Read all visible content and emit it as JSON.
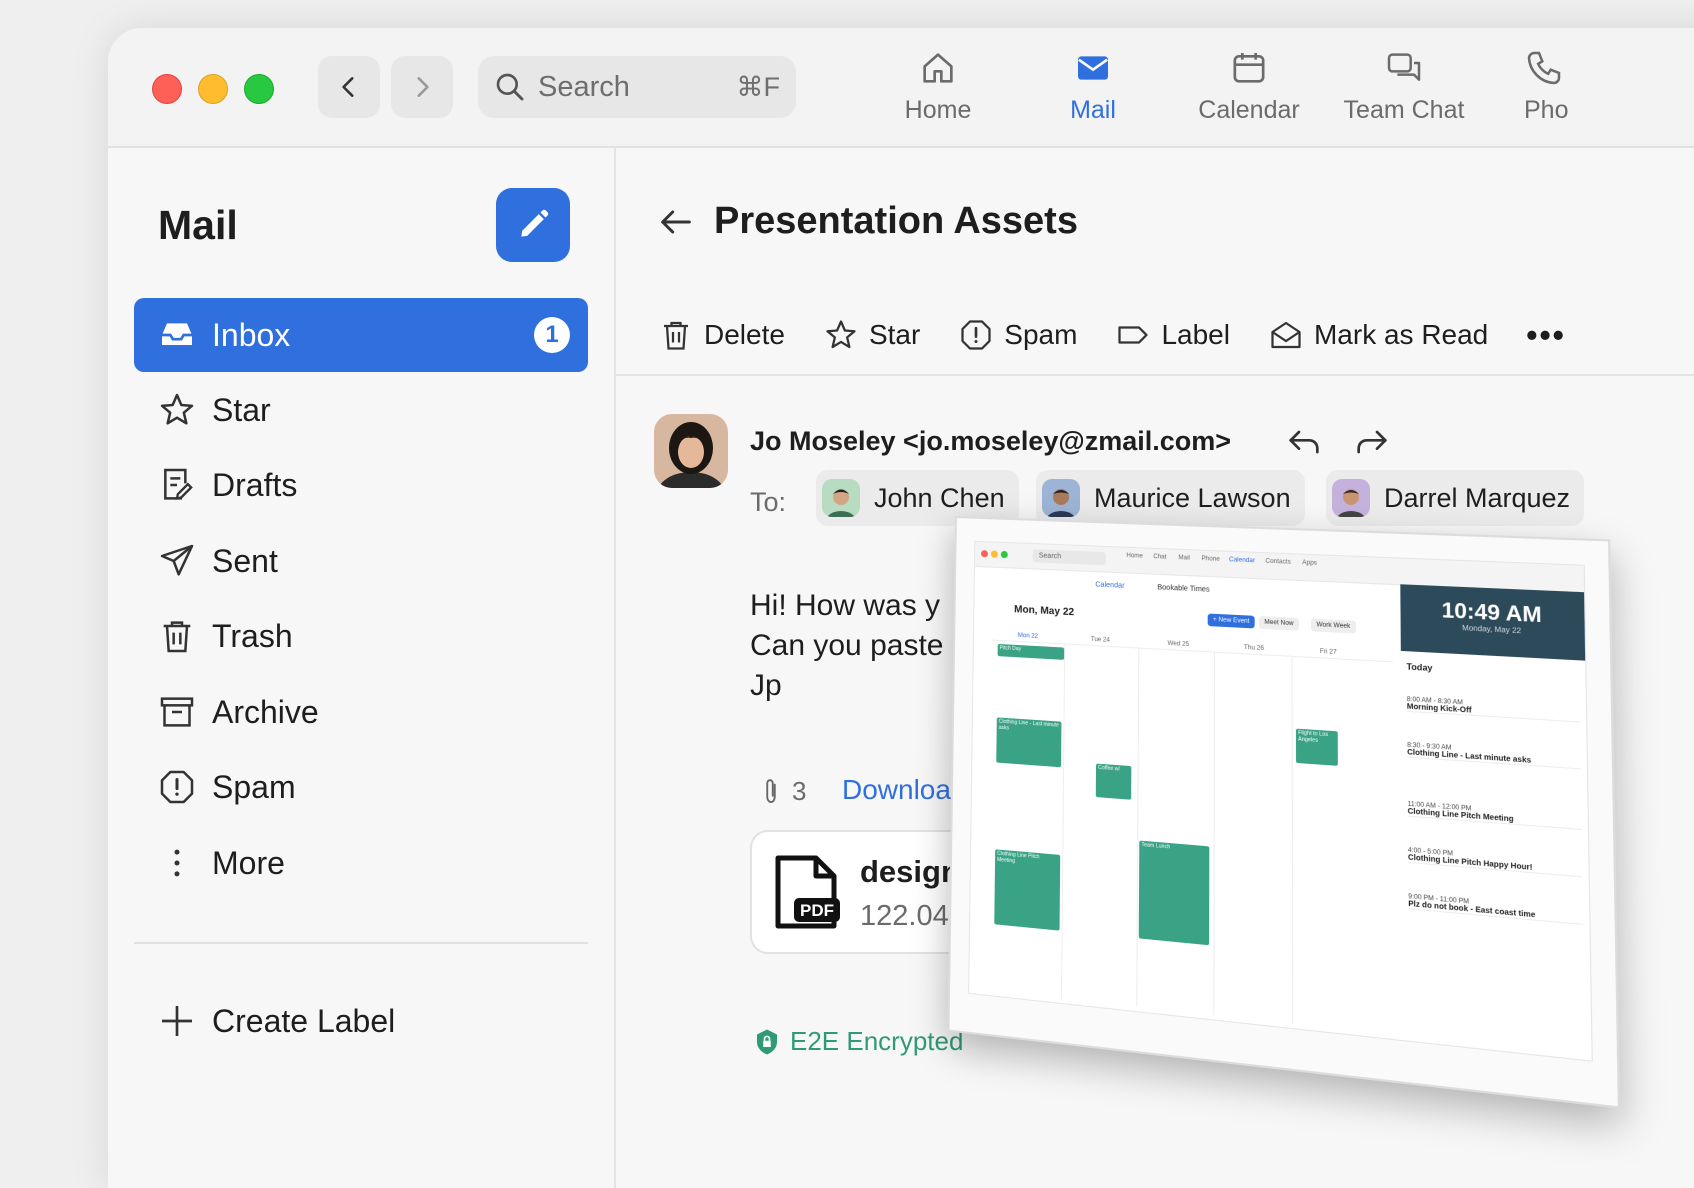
{
  "titlebar": {
    "search_placeholder": "Search",
    "search_shortcut": "⌘F",
    "nav": [
      {
        "label": "Home",
        "icon": "home-icon"
      },
      {
        "label": "Mail",
        "icon": "mail-icon",
        "active": true
      },
      {
        "label": "Calendar",
        "icon": "calendar-icon"
      },
      {
        "label": "Team Chat",
        "icon": "chat-icon"
      },
      {
        "label": "Pho",
        "icon": "phone-icon"
      }
    ]
  },
  "sidebar": {
    "title": "Mail",
    "folders": [
      {
        "label": "Inbox",
        "badge": "1",
        "icon": "inbox-icon",
        "active": true
      },
      {
        "label": "Star",
        "icon": "star-icon"
      },
      {
        "label": "Drafts",
        "icon": "drafts-icon"
      },
      {
        "label": "Sent",
        "icon": "sent-icon"
      },
      {
        "label": "Trash",
        "icon": "trash-icon"
      },
      {
        "label": "Archive",
        "icon": "archive-icon"
      },
      {
        "label": "Spam",
        "icon": "spam-icon"
      },
      {
        "label": "More",
        "icon": "more-vertical-icon"
      }
    ],
    "create_label": "Create Label"
  },
  "message": {
    "subject": "Presentation Assets",
    "toolbar": {
      "delete": "Delete",
      "star": "Star",
      "spam": "Spam",
      "label": "Label",
      "mark_read": "Mark as Read",
      "more": "•••"
    },
    "sender": "Jo Moseley <jo.moseley@zmail.com>",
    "to_label": "To:",
    "recipients": [
      "John Chen",
      "Maurice Lawson",
      "Darrel Marquez"
    ],
    "body_lines": [
      "Hi! How was y",
      "Can you paste",
      "Jp"
    ],
    "attachment_count": "3",
    "download_label": "Download",
    "file": {
      "name": "design",
      "size": "122.04",
      "type": "PDF"
    },
    "encryption": "E2E Encrypted"
  },
  "preview": {
    "search": "Search",
    "nav": [
      "Home",
      "Chat",
      "Mail",
      "Phone",
      "Calendar",
      "Contacts",
      "Apps"
    ],
    "tabs": [
      "Calendar",
      "Bookable Times"
    ],
    "date": "Mon, May 22",
    "new_event": "+ New Event",
    "meet_now": "Meet Now",
    "work_week": "Work Week",
    "days": [
      "Mon 22",
      "Tue 24",
      "Wed 25",
      "Thu 26",
      "Fri 27"
    ],
    "time": "10:49 AM",
    "clock_date": "Monday, May 22",
    "today": "Today",
    "agenda": [
      {
        "time": "8:00 AM - 8:30 AM",
        "title": "Morning Kick-Off"
      },
      {
        "time": "8:30 - 9:30 AM",
        "title": "Clothing Line - Last minute asks"
      },
      {
        "time": "11:00 AM - 12:00 PM",
        "title": "Clothing Line Pitch Meeting"
      },
      {
        "time": "4:00 - 5:00 PM",
        "title": "Clothing Line Pitch Happy Hour!"
      },
      {
        "time": "9:00 PM - 11:00 PM",
        "title": "Plz do not book - East coast time"
      }
    ],
    "events": [
      "Pitch Day",
      "Clothing Line - Last minute asks",
      "Coffee w/",
      "Team Lunch",
      "Flight to Los Angeles",
      "Clothing Line Pitch Meeting"
    ]
  },
  "colors": {
    "accent": "#2f6fde",
    "event": "#3aa385"
  }
}
